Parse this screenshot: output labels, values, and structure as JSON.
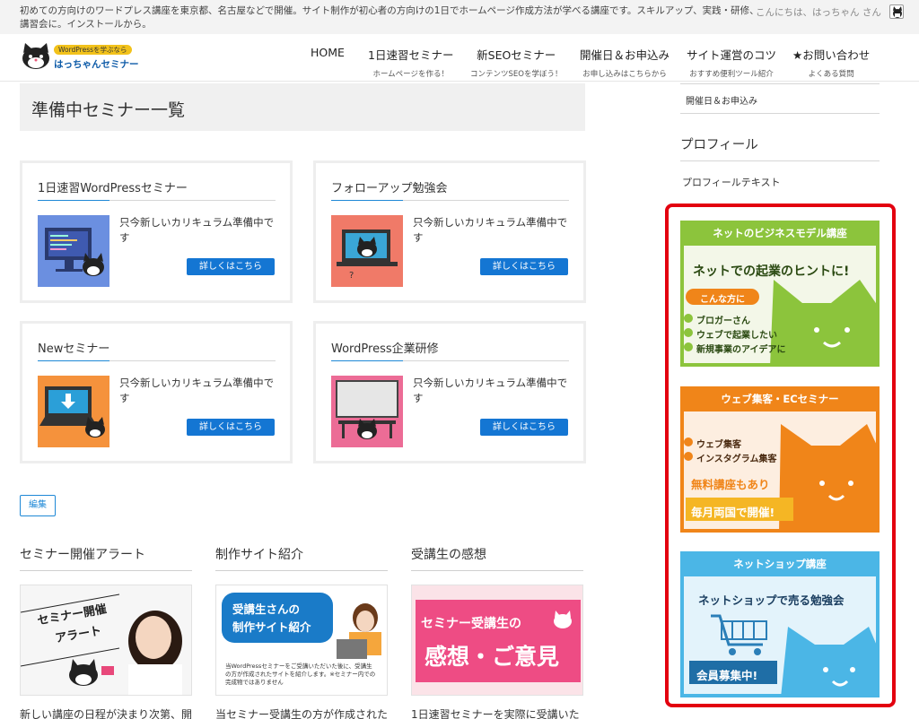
{
  "topbar": {
    "description": "初めての方向けのワードプレス講座を東京都、名古屋などで開催。サイト制作が初心者の方向けの1日でホームページ作成方法が学べる講座です。スキルアップ、実践・研修、講習会に。インストールから。",
    "greeting": "こんにちは、はっちゃん さん"
  },
  "logo": {
    "tagline": "WordPressを学ぶなら",
    "name": "はっちゃんセミナー"
  },
  "nav": [
    {
      "label": "HOME",
      "sub": ""
    },
    {
      "label": "1日速習セミナー",
      "sub": "ホームページを作る！"
    },
    {
      "label": "新SEOセミナー",
      "sub": "コンテンツSEOを学ぼう！"
    },
    {
      "label": "開催日＆お申込み",
      "sub": "お申し込みはこちらから"
    },
    {
      "label": "サイト運営のコツ",
      "sub": "おすすめ便利ツール紹介"
    },
    {
      "label": "★お問い合わせ",
      "sub": "よくある質問"
    }
  ],
  "main": {
    "title": "準備中セミナー一覧",
    "cards": [
      {
        "title": "1日速習WordPressセミナー",
        "text": "只今新しいカリキュラム準備中です",
        "button": "詳しくはこちら"
      },
      {
        "title": "フォローアップ勉強会",
        "text": "只今新しいカリキュラム準備中です",
        "button": "詳しくはこちら"
      },
      {
        "title": "Newセミナー",
        "text": "只今新しいカリキュラム準備中です",
        "button": "詳しくはこちら"
      },
      {
        "title": "WordPress企業研修",
        "text": "只今新しいカリキュラム準備中です",
        "button": "詳しくはこちら"
      }
    ],
    "edit_label": "編集",
    "columns": [
      {
        "title": "セミナー開催アラート",
        "img_text_1": "セミナー開催",
        "img_text_2": "アラート",
        "text": "新しい講座の日程が決まり次第、開"
      },
      {
        "title": "制作サイト紹介",
        "img_text_1": "受講生さんの",
        "img_text_2": "制作サイト紹介",
        "img_small": "当WordPressセミナーをご受講いただいた後に、受講生の方が作成されたサイトを紹介します。※セミナー内での完成物ではありません",
        "text": "当セミナー受講生の方が作成された"
      },
      {
        "title": "受講生の感想",
        "img_text_1": "セミナー受講生の",
        "img_text_2": "感想・ご意見",
        "text": "1日速習セミナーを実際に受講いた"
      }
    ]
  },
  "sidebar": {
    "link": "開催日＆お申込み",
    "profile_title": "プロフィール",
    "profile_text": "プロフィールテキスト",
    "banners": [
      {
        "head": "ネットのビジネスモデル講座",
        "headline": "ネットでの起業のヒントに!",
        "pill": "こんな方に",
        "items": [
          "ブロガーさん",
          "ウェブで起業したい",
          "新規事業のアイデアに"
        ]
      },
      {
        "head": "ウェブ集客・ECセミナー",
        "items": [
          "ウェブ集客",
          "インスタグラム集客"
        ],
        "free": "無料講座もあり",
        "monthly": "毎月両国で開催!"
      },
      {
        "head": "ネットショップ講座",
        "headline": "ネットショップで売る勉強会",
        "badge": "会員募集中!"
      }
    ]
  },
  "colors": {
    "accent": "#1476d3",
    "highlight": "#e3000f",
    "green": "#8cc43c",
    "orange": "#f08519",
    "sky": "#4bb6e6"
  }
}
